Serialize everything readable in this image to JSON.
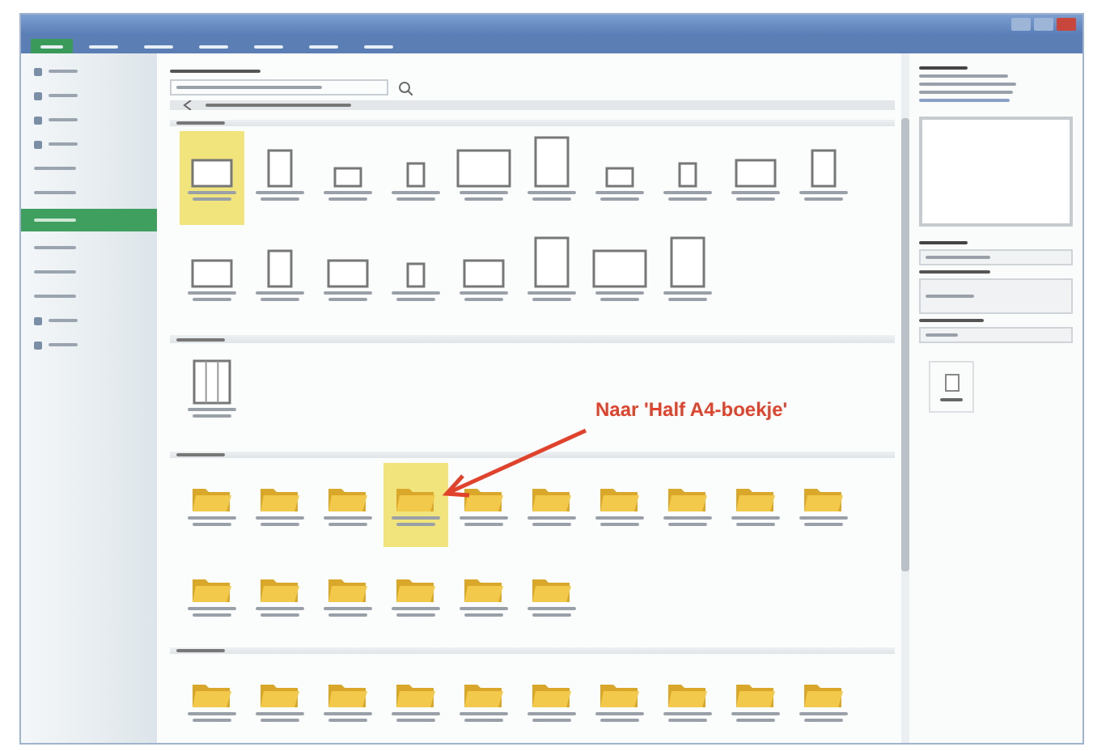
{
  "window": {
    "tabs": [
      {
        "selected": true
      },
      {
        "selected": false
      },
      {
        "selected": false
      },
      {
        "selected": false
      },
      {
        "selected": false
      },
      {
        "selected": false
      },
      {
        "selected": false
      }
    ]
  },
  "sidebar": {
    "items": [
      {
        "kind": "icon",
        "selected": false
      },
      {
        "kind": "icon",
        "selected": false
      },
      {
        "kind": "icon",
        "selected": false
      },
      {
        "kind": "icon",
        "selected": false
      },
      {
        "kind": "text",
        "selected": false
      },
      {
        "kind": "text",
        "selected": false
      },
      {
        "kind": "text",
        "selected": true
      },
      {
        "kind": "text",
        "selected": false
      },
      {
        "kind": "text",
        "selected": false
      },
      {
        "kind": "text",
        "selected": false
      },
      {
        "kind": "icon",
        "selected": false
      },
      {
        "kind": "icon",
        "selected": false
      }
    ]
  },
  "templates": {
    "sections": [
      {
        "kind": "pages",
        "tiles": [
          {
            "kind": "landscape",
            "selected": true
          },
          {
            "kind": "portrait",
            "selected": false
          },
          {
            "kind": "landscape-small",
            "selected": false
          },
          {
            "kind": "portrait-small",
            "selected": false
          },
          {
            "kind": "landscape-large",
            "selected": false
          },
          {
            "kind": "portrait-large",
            "selected": false
          },
          {
            "kind": "landscape-small",
            "selected": false
          },
          {
            "kind": "portrait-small",
            "selected": false
          },
          {
            "kind": "landscape",
            "selected": false
          },
          {
            "kind": "portrait",
            "selected": false
          },
          {
            "kind": "landscape",
            "selected": false
          },
          {
            "kind": "portrait",
            "selected": false
          },
          {
            "kind": "landscape",
            "selected": false
          },
          {
            "kind": "portrait-small",
            "selected": false
          },
          {
            "kind": "landscape",
            "selected": false
          },
          {
            "kind": "portrait-large",
            "selected": false
          },
          {
            "kind": "landscape-large",
            "selected": false
          },
          {
            "kind": "portrait-large",
            "selected": false
          }
        ]
      },
      {
        "kind": "pages",
        "tiles": [
          {
            "kind": "grid",
            "selected": false
          }
        ]
      },
      {
        "kind": "folders",
        "tiles": [
          {
            "kind": "folder",
            "selected": false
          },
          {
            "kind": "folder",
            "selected": false
          },
          {
            "kind": "folder",
            "selected": false
          },
          {
            "kind": "folder",
            "selected": true
          },
          {
            "kind": "folder",
            "selected": false
          },
          {
            "kind": "folder",
            "selected": false
          },
          {
            "kind": "folder",
            "selected": false
          },
          {
            "kind": "folder",
            "selected": false
          },
          {
            "kind": "folder",
            "selected": false
          },
          {
            "kind": "folder",
            "selected": false
          },
          {
            "kind": "folder",
            "selected": false
          },
          {
            "kind": "folder",
            "selected": false
          },
          {
            "kind": "folder",
            "selected": false
          },
          {
            "kind": "folder",
            "selected": false
          },
          {
            "kind": "folder",
            "selected": false
          },
          {
            "kind": "folder",
            "selected": false
          }
        ]
      },
      {
        "kind": "folders",
        "tiles": [
          {
            "kind": "folder",
            "selected": false
          },
          {
            "kind": "folder",
            "selected": false
          },
          {
            "kind": "folder",
            "selected": false
          },
          {
            "kind": "folder",
            "selected": false
          },
          {
            "kind": "folder",
            "selected": false
          },
          {
            "kind": "folder",
            "selected": false
          },
          {
            "kind": "folder",
            "selected": false
          },
          {
            "kind": "folder",
            "selected": false
          },
          {
            "kind": "folder",
            "selected": false
          },
          {
            "kind": "folder",
            "selected": false
          }
        ]
      }
    ]
  },
  "annotation": {
    "text": "Naar 'Half A4-boekje'"
  }
}
